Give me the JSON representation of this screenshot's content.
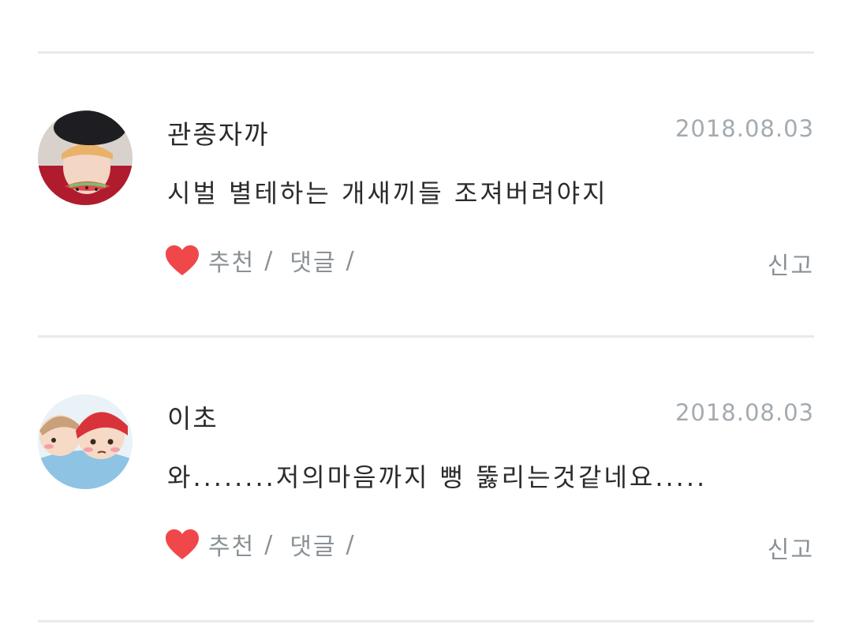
{
  "comments": [
    {
      "author": "관종자까",
      "date": "2018.08.03",
      "text": "시벌 별테하는 개새끼들 조져버려야지",
      "recommend_label": "추천",
      "recommend_sep": "/",
      "reply_label": "댓글",
      "reply_sep": "/",
      "report_label": "신고"
    },
    {
      "author": "이초",
      "date": "2018.08.03",
      "text": "와........저의마음까지 뻥 뚫리는것같네요.....",
      "recommend_label": "추천",
      "recommend_sep": "/",
      "reply_label": "댓글",
      "reply_sep": "/",
      "report_label": "신고"
    }
  ],
  "colors": {
    "heart": "#f0474a",
    "divider": "#e7ebee",
    "text": "#2b2b2b",
    "muted": "#8a9196",
    "date": "#a4abb0"
  },
  "icons": [
    "heart-icon",
    "avatar-image"
  ]
}
